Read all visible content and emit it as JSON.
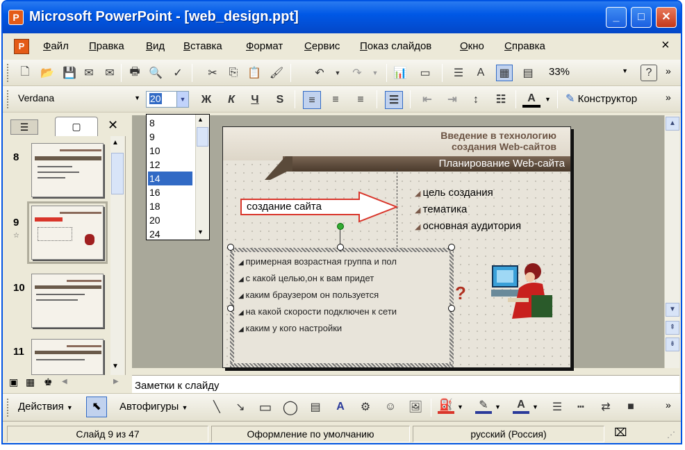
{
  "window": {
    "title": "Microsoft PowerPoint - [web_design.ppt]",
    "app_icon": "powerpoint-icon"
  },
  "menu": {
    "items": [
      "Файл",
      "Правка",
      "Вид",
      "Вставка",
      "Формат",
      "Сервис",
      "Показ слайдов",
      "Окно",
      "Справка"
    ],
    "close_glyph": "×"
  },
  "standard_toolbar": {
    "zoom": "33%",
    "help_icon": "?"
  },
  "format_toolbar": {
    "font": "Verdana",
    "font_size": "20",
    "bold": "Ж",
    "italic": "К",
    "underline": "Ч",
    "shadow": "S",
    "designer_label": "Конструктор",
    "font_color_letter": "A"
  },
  "font_size_dropdown": {
    "options": [
      "8",
      "9",
      "10",
      "12",
      "14",
      "16",
      "18",
      "20",
      "24"
    ],
    "selected": "14"
  },
  "slides_panel": {
    "thumbnails": [
      {
        "number": "8"
      },
      {
        "number": "9",
        "selected": true
      },
      {
        "number": "10"
      },
      {
        "number": "11"
      }
    ]
  },
  "slide": {
    "title_line1": "Введение в технологию",
    "title_line2": "создания Web-сайтов",
    "subtitle": "Планирование Web-сайта",
    "arrow_text": "создание сайта",
    "right_bullets": [
      "цель создания",
      "тематика",
      "основная аудитория"
    ],
    "box_bullets": [
      "примерная возрастная группа и пол",
      "с какой целью,он к вам придет",
      "каким браузером он пользуется",
      "на какой скорости подключен к сети",
      "каким у кого настройки"
    ],
    "question_mark": "?"
  },
  "notes": {
    "text": "Заметки к слайду"
  },
  "drawing_toolbar": {
    "actions_label": "Действия",
    "autoshapes_label": "Автофигуры",
    "text_color_letter": "A"
  },
  "status": {
    "slide": "Слайд 9 из 47",
    "design": "Оформление по умолчанию",
    "language": "русский (Россия)"
  },
  "colors": {
    "titlebar": "#0058e6",
    "selection": "#316ac5",
    "slide_band": "#5a4a3a",
    "arrow_red": "#d9352a"
  }
}
